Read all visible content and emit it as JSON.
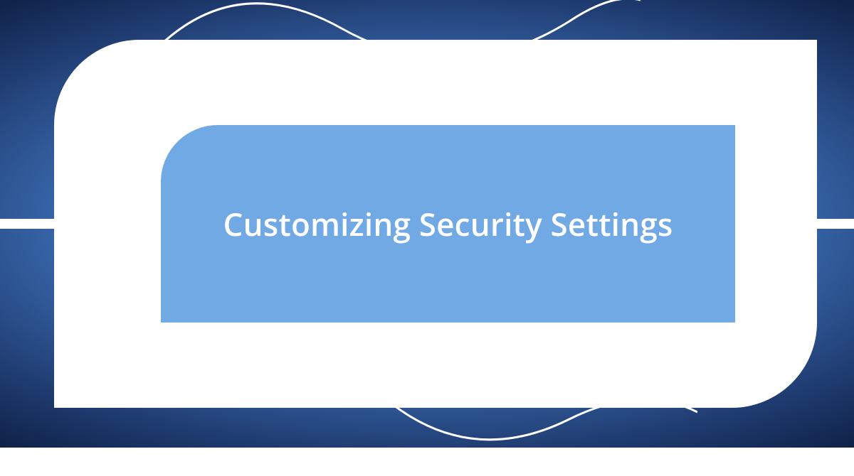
{
  "hero": {
    "title": "Customizing Security Settings"
  },
  "colors": {
    "inner_panel": "#70a9e4",
    "outer_panel": "#ffffff",
    "text": "#ffffff"
  }
}
